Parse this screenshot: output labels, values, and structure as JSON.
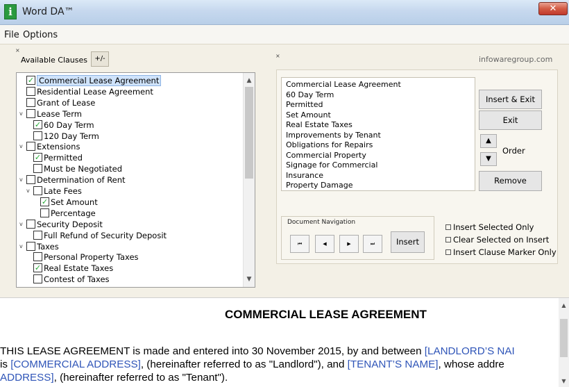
{
  "window": {
    "title": "Word DA™",
    "icon_letter": "i",
    "close_glyph": "✕"
  },
  "menu": {
    "items": [
      "File",
      "Options"
    ]
  },
  "left": {
    "label": "Available Clauses",
    "toggle_button": "+/-",
    "tree": [
      {
        "label": "Commercial Lease Agreement",
        "level": 0,
        "checked": true,
        "expander": "",
        "selected": true
      },
      {
        "label": "Residential Lease Agreement",
        "level": 0,
        "checked": false,
        "expander": ""
      },
      {
        "label": "Grant of Lease",
        "level": 0,
        "checked": false,
        "expander": ""
      },
      {
        "label": "Lease Term",
        "level": 0,
        "checked": false,
        "expander": "v"
      },
      {
        "label": "60 Day Term",
        "level": 1,
        "checked": true,
        "expander": ""
      },
      {
        "label": "120 Day Term",
        "level": 1,
        "checked": false,
        "expander": ""
      },
      {
        "label": "Extensions",
        "level": 0,
        "checked": false,
        "expander": "v"
      },
      {
        "label": "Permitted",
        "level": 1,
        "checked": true,
        "expander": ""
      },
      {
        "label": "Must be Negotiated",
        "level": 1,
        "checked": false,
        "expander": ""
      },
      {
        "label": "Determination of Rent",
        "level": 0,
        "checked": false,
        "expander": "v"
      },
      {
        "label": "Late Fees",
        "level": 1,
        "checked": false,
        "expander": "v"
      },
      {
        "label": "Set Amount",
        "level": 2,
        "checked": true,
        "expander": ""
      },
      {
        "label": "Percentage",
        "level": 2,
        "checked": false,
        "expander": ""
      },
      {
        "label": "Security Deposit",
        "level": 0,
        "checked": false,
        "expander": "v"
      },
      {
        "label": "Full Refund of Security Deposit",
        "level": 1,
        "checked": false,
        "expander": ""
      },
      {
        "label": "Taxes",
        "level": 0,
        "checked": false,
        "expander": "v"
      },
      {
        "label": "Personal Property Taxes",
        "level": 1,
        "checked": false,
        "expander": ""
      },
      {
        "label": "Real Estate Taxes",
        "level": 1,
        "checked": true,
        "expander": ""
      },
      {
        "label": "Contest of Taxes",
        "level": 1,
        "checked": false,
        "expander": ""
      }
    ]
  },
  "right": {
    "site": "infowaregroup.com",
    "selected_clauses": [
      "Commercial Lease Agreement",
      "60 Day Term",
      "Permitted",
      "Set Amount",
      "Real Estate Taxes",
      "Improvements by Tenant",
      "Obligations for Repairs",
      "Commercial Property",
      "Signage for Commercial",
      "Insurance",
      "Property Damage"
    ],
    "buttons": {
      "insert_exit": "Insert & Exit",
      "exit": "Exit",
      "order": "Order",
      "remove": "Remove",
      "up_glyph": "▲",
      "down_glyph": "▼"
    },
    "nav": {
      "label": "Document Navigation",
      "first": "⏮",
      "prev": "◀",
      "next": "▶",
      "last": "⏭",
      "insert": "Insert"
    },
    "options": [
      {
        "label": "Insert Selected Only",
        "checked": false
      },
      {
        "label": "Clear Selected on Insert",
        "checked": false
      },
      {
        "label": "Insert Clause Marker Only",
        "checked": false
      }
    ]
  },
  "document": {
    "title": "COMMERCIAL LEASE AGREEMENT",
    "line1": "THIS LEASE AGREEMENT is made and entered into 30 November 2015, by and between ",
    "line1_ph": "[LANDLORD’S NAI",
    "line2_a": "is ",
    "line2_ph1": "[COMMERCIAL ADDRESS]",
    "line2_b": ", (hereinafter referred to as \"Landlord\"), and ",
    "line2_ph2": "[TENANT’S NAME]",
    "line2_c": ", whose addre",
    "line3_ph": "ADDRESS]",
    "line3_b": ", (hereinafter referred to as \"Tenant\")."
  }
}
